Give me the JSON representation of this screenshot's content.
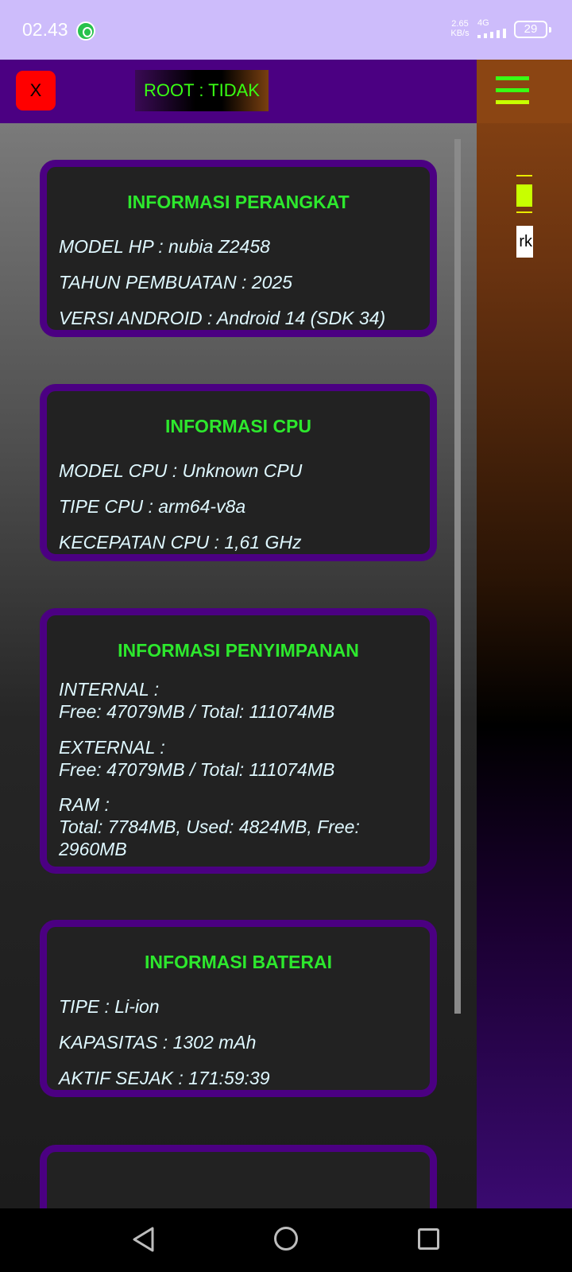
{
  "status_bar": {
    "time": "02.43",
    "speed_value": "2.65",
    "speed_unit": "KB/s",
    "network": "4G",
    "battery": "29"
  },
  "header": {
    "close_label": "X",
    "root_label": "ROOT : TIDAK"
  },
  "sidebar": {
    "menu_icon_colors": [
      "#39ff14",
      "#39ff14",
      "#c8ff00"
    ],
    "partial_card_text": "rk"
  },
  "cards": [
    {
      "title": "INFORMASI PERANGKAT",
      "lines": [
        "MODEL HP : nubia Z2458",
        "TAHUN PEMBUATAN : 2025",
        "VERSI ANDROID : Android 14 (SDK 34)"
      ]
    },
    {
      "title": "INFORMASI CPU",
      "lines": [
        "MODEL CPU : Unknown CPU",
        "TIPE CPU : arm64-v8a",
        "KECEPATAN CPU : 1,61 GHz"
      ]
    },
    {
      "title": "INFORMASI PENYIMPANAN",
      "lines": [
        "INTERNAL :",
        "Free: 47079MB / Total: 111074MB",
        "EXTERNAL :",
        "Free: 47079MB / Total: 111074MB",
        "RAM :",
        "Total: 7784MB, Used: 4824MB, Free:",
        "2960MB"
      ]
    },
    {
      "title": "INFORMASI BATERAI",
      "lines": [
        "TIPE : Li-ion",
        "KAPASITAS : 1302 mAh",
        "AKTIF SEJAK : 171:59:39"
      ]
    }
  ],
  "colors": {
    "accent_purple": "#4b0082",
    "title_green": "#2de82d",
    "text_cyan": "#dff8ff",
    "close_red": "#ff0000"
  }
}
